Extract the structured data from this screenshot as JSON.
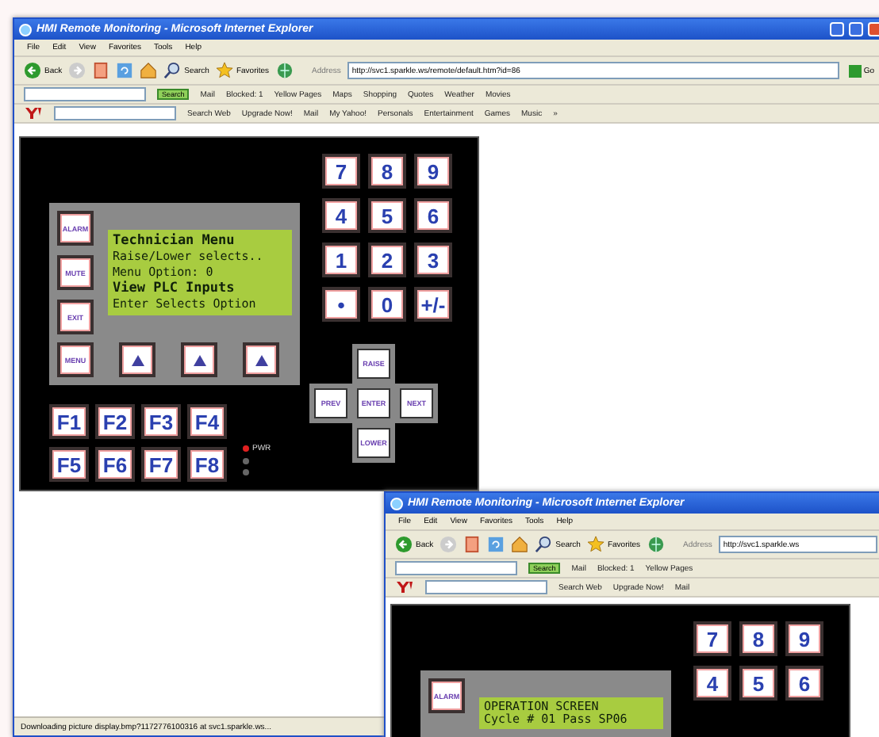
{
  "windows": [
    {
      "title": "HMI Remote Monitoring - Microsoft Internet Explorer",
      "controls": true,
      "menu": [
        "File",
        "Edit",
        "View",
        "Favorites",
        "Tools",
        "Help"
      ],
      "toolbar": [
        {
          "kind": "back",
          "label": "Back"
        },
        {
          "kind": "forward"
        },
        {
          "kind": "stop"
        },
        {
          "kind": "refresh"
        },
        {
          "kind": "home"
        },
        {
          "kind": "search",
          "label": "Search"
        },
        {
          "kind": "favorites",
          "label": "Favorites"
        },
        {
          "kind": "media"
        }
      ],
      "address_label": "Address",
      "address": "http://svc1.sparkle.ws/remote/default.htm?id=86",
      "go": "Go",
      "links_bar": [
        "Mail",
        "Blocked: 1",
        "Yellow Pages",
        "Maps",
        "Shopping",
        "Quotes",
        "Weather",
        "Movies"
      ],
      "search_button": "Search",
      "yahoo_bar": [
        "Search Web",
        "Upgrade Now!",
        "Mail",
        "My Yahoo!",
        "Personals",
        "Entertainment",
        "Games",
        "Music"
      ],
      "more": "»",
      "hmi": {
        "lcd_lines": [
          {
            "text": "Technician Menu",
            "bold": true
          },
          {
            "text": "Raise/Lower selects..",
            "bold": false
          },
          {
            "text": "Menu Option:   0",
            "bold": false
          },
          {
            "text": "View PLC Inputs",
            "bold": true
          },
          {
            "text": "Enter Selects Option",
            "bold": false
          }
        ],
        "side_keys": [
          "ALARM",
          "MUTE",
          "EXIT"
        ],
        "lcd_keys": [
          {
            "kind": "label",
            "label": "MENU"
          },
          {
            "kind": "arrow"
          },
          {
            "kind": "arrow"
          },
          {
            "kind": "arrow"
          }
        ],
        "function_keys": [
          "F1",
          "F2",
          "F3",
          "F4",
          "F5",
          "F6",
          "F7",
          "F8"
        ],
        "leds": [
          {
            "label": "PWR",
            "on": true
          },
          {
            "on": false
          },
          {
            "on": false
          }
        ],
        "numpad": [
          "7",
          "8",
          "9",
          "4",
          "5",
          "6",
          "1",
          "2",
          "3",
          "•",
          "0",
          "+/-"
        ],
        "nav_keys": {
          "up": "RAISE",
          "left": "PREV",
          "center": "ENTER",
          "right": "NEXT",
          "down": "LOWER"
        }
      },
      "status": "Downloading picture display.bmp?1172776100316 at svc1.sparkle.ws..."
    },
    {
      "title": "HMI Remote Monitoring - Microsoft Internet Explorer",
      "controls": false,
      "menu": [
        "File",
        "Edit",
        "View",
        "Favorites",
        "Tools",
        "Help"
      ],
      "toolbar": [
        {
          "kind": "back",
          "label": "Back"
        },
        {
          "kind": "forward"
        },
        {
          "kind": "stop"
        },
        {
          "kind": "refresh"
        },
        {
          "kind": "home"
        },
        {
          "kind": "search",
          "label": "Search"
        },
        {
          "kind": "favorites",
          "label": "Favorites"
        },
        {
          "kind": "media"
        }
      ],
      "address_label": "Address",
      "address": "http://svc1.sparkle.ws",
      "links_bar": [
        "Mail",
        "Blocked: 1",
        "Yellow Pages"
      ],
      "search_button": "Search",
      "yahoo_bar": [
        "Search Web",
        "Upgrade Now!",
        "Mail"
      ],
      "hmi": {
        "lcd_lines": [
          {
            "text": "OPERATION SCREEN",
            "bold": false
          },
          {
            "text": "Cycle # 01 Pass SP06",
            "bold": false
          }
        ],
        "side_keys": [
          "ALARM"
        ],
        "numpad": [
          "7",
          "8",
          "9",
          "4",
          "5",
          "6"
        ]
      }
    }
  ]
}
